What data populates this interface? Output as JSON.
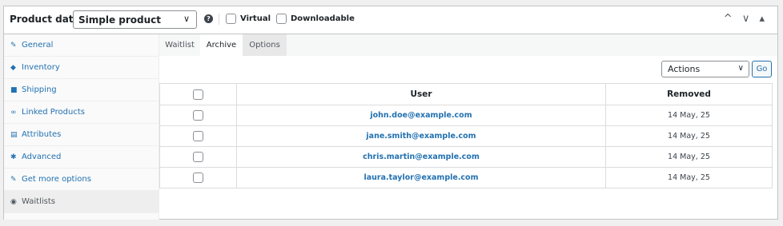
{
  "header": {
    "title": "Product data —",
    "product_type": "Simple product",
    "help": "?",
    "virtual_label": "Virtual",
    "downloadable_label": "Downloadable",
    "controls": "^ ∨ ▴"
  },
  "sidebar": {
    "items": [
      {
        "label": "General",
        "icon": "wrench-icon",
        "glyph": "✎"
      },
      {
        "label": "Inventory",
        "icon": "tag-icon",
        "glyph": "◆"
      },
      {
        "label": "Shipping",
        "icon": "truck-icon",
        "glyph": "■"
      },
      {
        "label": "Linked Products",
        "icon": "link-icon",
        "glyph": "∞"
      },
      {
        "label": "Attributes",
        "icon": "list-icon",
        "glyph": "▤"
      },
      {
        "label": "Advanced",
        "icon": "gear-icon",
        "glyph": "✱"
      },
      {
        "label": "Get more options",
        "icon": "plugin-icon",
        "glyph": "✎"
      },
      {
        "label": "Waitlists",
        "icon": "waitlist-icon",
        "glyph": "◉"
      }
    ]
  },
  "tabs": {
    "waitlist": "Waitlist",
    "archive": "Archive",
    "options": "Options"
  },
  "bulk": {
    "selected": "Actions",
    "go": "Go"
  },
  "table": {
    "headers": {
      "user": "User",
      "removed": "Removed"
    },
    "rows": [
      {
        "user": "john.doe@example.com",
        "removed": "14 May, 25"
      },
      {
        "user": "jane.smith@example.com",
        "removed": "14 May, 25"
      },
      {
        "user": "chris.martin@example.com",
        "removed": "14 May, 25"
      },
      {
        "user": "laura.taylor@example.com",
        "removed": "14 May, 25"
      }
    ]
  }
}
